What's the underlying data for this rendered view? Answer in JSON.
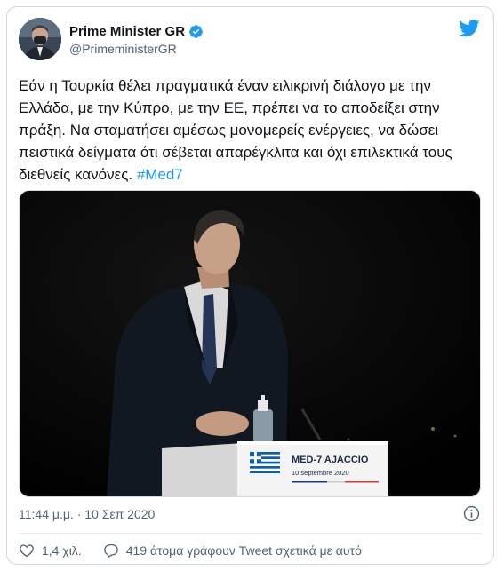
{
  "tweet": {
    "author": {
      "display_name": "Prime Minister GR",
      "handle": "@PrimeministerGR",
      "verified": true
    },
    "text_main": "Εάν η Τουρκία θέλει πραγματικά έναν ειλικρινή διάλογο με την Ελλάδα, με την Κύπρο, με την ΕΕ, πρέπει να το αποδείξει στην πράξη. Να σταματήσει αμέσως μονομερείς ενέργειες, να δώσει πειστικά δείγματα ότι σέβεται απαρέγκλιτα και όχι επιλεκτικά τους διεθνείς κανόνες. ",
    "hashtag": "#Med7",
    "media": {
      "podium_title": "MED-7 AJACCIO",
      "podium_date": "10 septembre 2020"
    },
    "time": "11:44 μ.μ.",
    "separator": "·",
    "date": "10 Σεπ 2020",
    "likes": "1,4 χιλ.",
    "discussion": "419 άτομα γράφουν Tweet σχετικά με αυτό"
  },
  "colors": {
    "accent": "#1d9bf0",
    "text": "#0f1419",
    "secondary": "#536471",
    "border": "#cfd9de"
  },
  "icons": [
    "verified-badge-icon",
    "twitter-bird-icon",
    "info-icon",
    "heart-icon",
    "speech-bubble-icon"
  ]
}
